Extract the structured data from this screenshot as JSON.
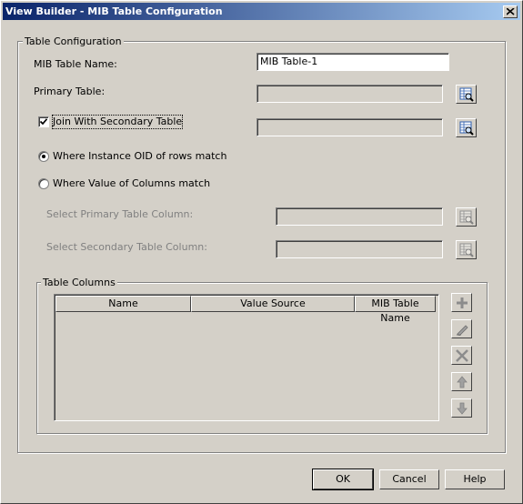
{
  "window": {
    "title": "View Builder - MIB Table Configuration"
  },
  "config_group": {
    "legend": "Table Configuration"
  },
  "fields": {
    "mib_table_name_label": "MIB Table Name:",
    "mib_table_name_value": "MIB Table-1",
    "primary_table_label": "Primary Table:",
    "primary_table_value": "",
    "join_label": "Join With Secondary Table",
    "join_checked": true,
    "secondary_table_value": ""
  },
  "radios": {
    "instance_oid_label": "Where Instance OID of rows match",
    "instance_oid_selected": true,
    "column_value_label": "Where Value of Columns match",
    "column_value_selected": false
  },
  "column_select": {
    "primary_label": "Select Primary Table Column:",
    "secondary_label": "Select Secondary Table Column:"
  },
  "table_group": {
    "legend": "Table Columns",
    "columns": [
      "Name",
      "Value Source",
      "MIB Table Name"
    ],
    "rows": []
  },
  "buttons": {
    "ok": "OK",
    "cancel": "Cancel",
    "help": "Help"
  },
  "icons": {
    "lookup": "search-table-icon",
    "add": "add-icon",
    "edit": "edit-icon",
    "delete": "delete-icon",
    "up": "move-up-icon",
    "down": "move-down-icon",
    "close": "close-icon"
  },
  "colors": {
    "title_start": "#0a246a",
    "title_end": "#a6caf0",
    "face": "#d4d0c8",
    "disabled_text": "#808080"
  }
}
